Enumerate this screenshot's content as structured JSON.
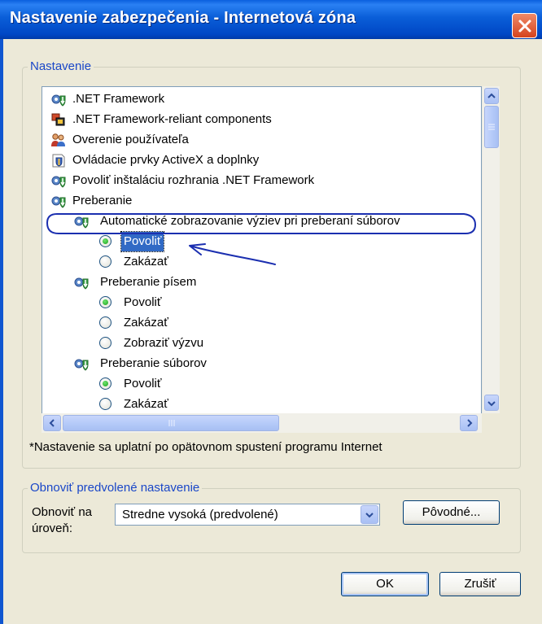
{
  "window": {
    "title": "Nastavenie zabezpečenia - Internetová zóna",
    "close_label": "×"
  },
  "settings_group": {
    "legend": "Nastavenie",
    "items": [
      {
        "label": ".NET Framework",
        "icon": "gear-shield-icon",
        "level": 0
      },
      {
        "label": ".NET Framework-reliant components",
        "icon": "component-icon",
        "level": 0
      },
      {
        "label": "Overenie používateľa",
        "icon": "users-icon",
        "level": 0
      },
      {
        "label": "Ovládacie prvky ActiveX a doplnky",
        "icon": "activex-icon",
        "level": 0
      },
      {
        "label": "Povoliť inštaláciu rozhrania .NET Framework",
        "icon": "gear-shield-icon",
        "level": 0
      },
      {
        "label": "Preberanie",
        "icon": "gear-shield-icon",
        "level": 0
      },
      {
        "label": "Automatické zobrazovanie výziev pri preberaní súborov",
        "icon": "gear-shield-icon",
        "level": 1
      },
      {
        "label": "Povoliť",
        "radio": true,
        "checked": true,
        "selected": true,
        "level": 2
      },
      {
        "label": "Zakázať",
        "radio": true,
        "checked": false,
        "level": 2
      },
      {
        "label": "Preberanie písem",
        "icon": "gear-shield-icon",
        "level": 1
      },
      {
        "label": "Povoliť",
        "radio": true,
        "checked": true,
        "level": 2
      },
      {
        "label": "Zakázať",
        "radio": true,
        "checked": false,
        "level": 2
      },
      {
        "label": "Zobraziť výzvu",
        "radio": true,
        "checked": false,
        "level": 2
      },
      {
        "label": "Preberanie súborov",
        "icon": "gear-shield-icon",
        "level": 1
      },
      {
        "label": "Povoliť",
        "radio": true,
        "checked": true,
        "level": 2
      },
      {
        "label": "Zakázať",
        "radio": true,
        "checked": false,
        "level": 2
      }
    ]
  },
  "note": "*Nastavenie sa uplatní po opätovnom spustení programu Internet",
  "reset_group": {
    "legend": "Obnoviť predvolené nastavenie",
    "level_label_line1": "Obnoviť na",
    "level_label_line2": "úroveň:",
    "selected_level": "Stredne vysoká (predvolené)",
    "default_button": "Pôvodné..."
  },
  "footer": {
    "ok": "OK",
    "cancel": "Zrušiť"
  },
  "colors": {
    "title_bar": "#0a5ed8",
    "selection": "#316ac5",
    "annotation": "#1b2fb0"
  }
}
